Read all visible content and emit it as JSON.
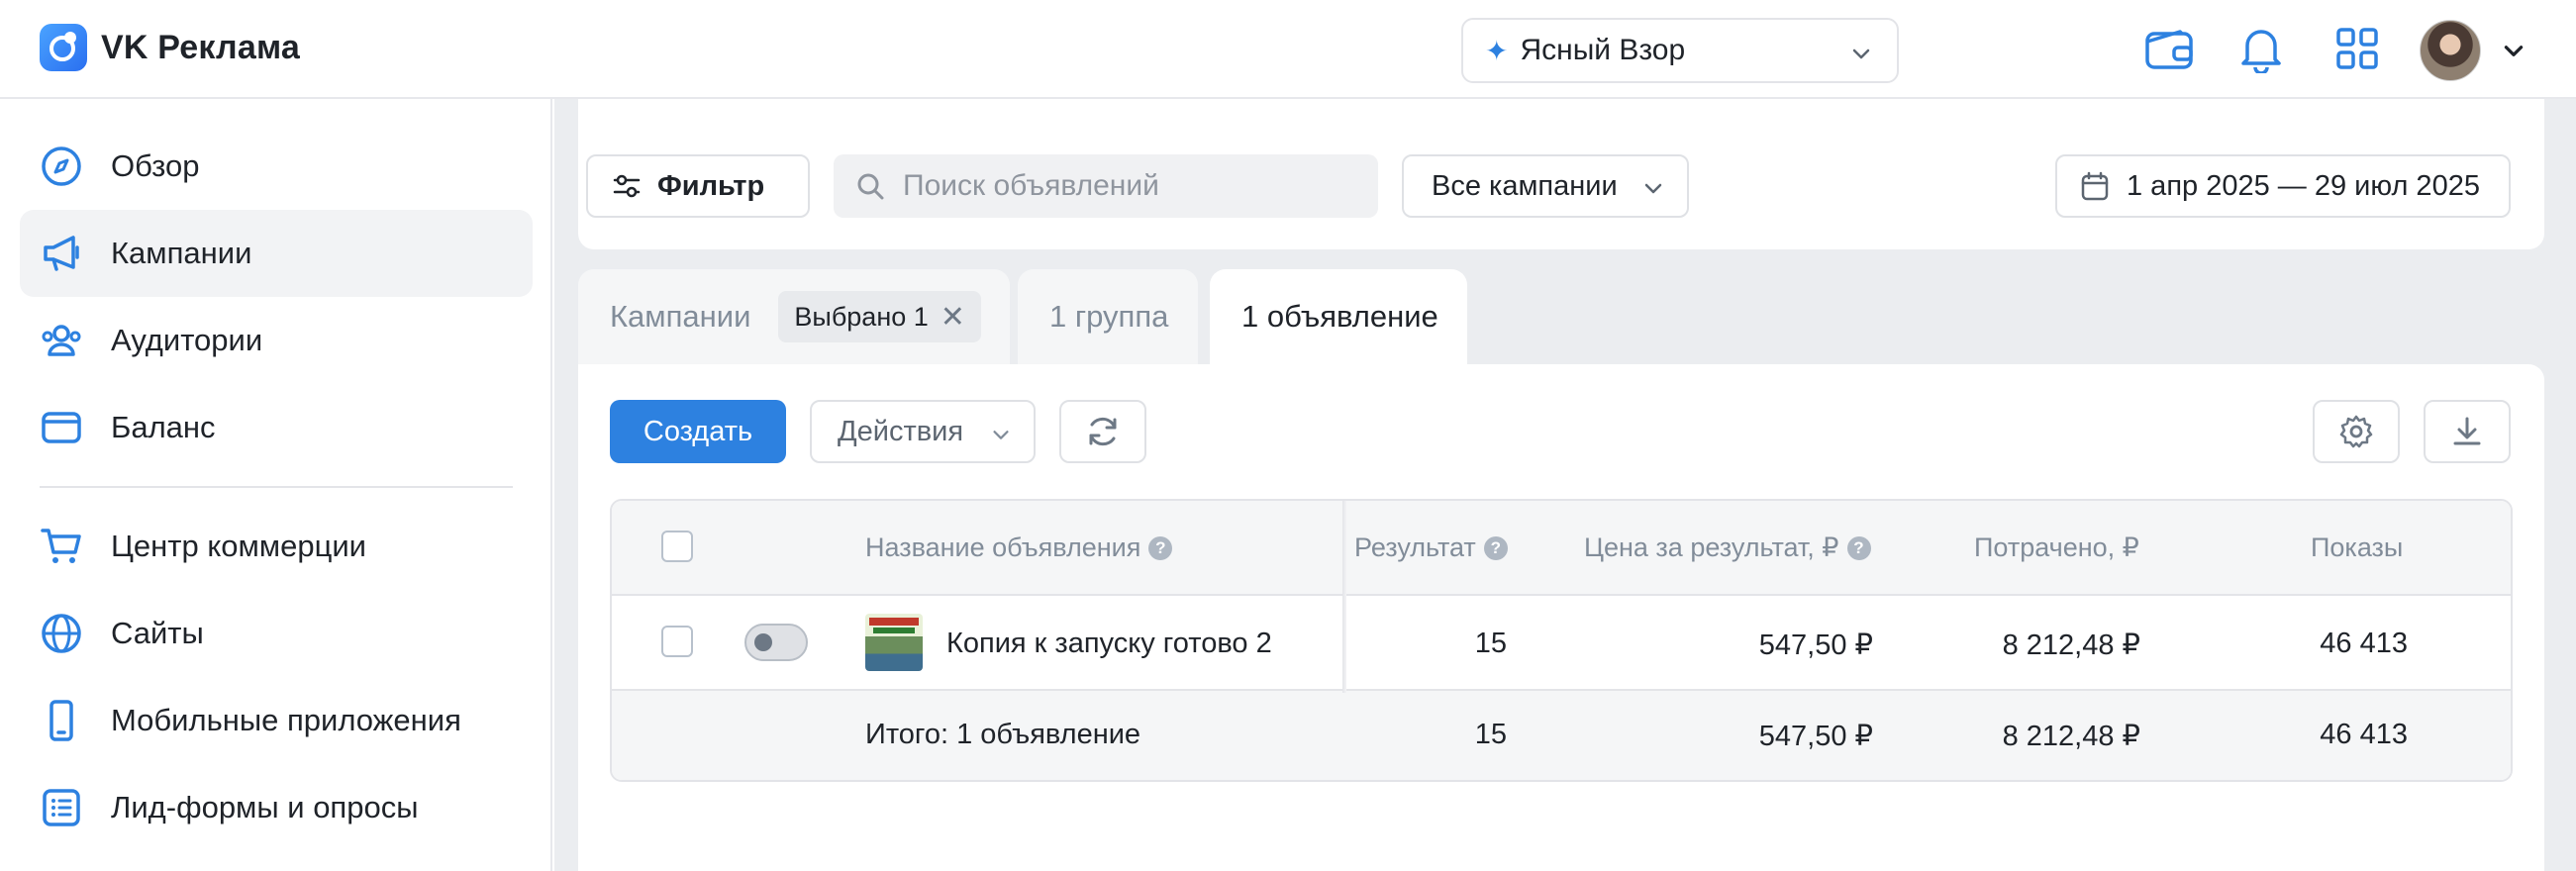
{
  "app": {
    "title": "VK Реклама"
  },
  "account": {
    "name": "Ясный Взор"
  },
  "sidebar": {
    "items": [
      {
        "label": "Обзор",
        "icon": "compass-icon"
      },
      {
        "label": "Кампании",
        "icon": "megaphone-icon",
        "active": true
      },
      {
        "label": "Аудитории",
        "icon": "users-icon"
      },
      {
        "label": "Баланс",
        "icon": "wallet-icon"
      },
      {
        "label": "Центр коммерции",
        "icon": "cart-icon"
      },
      {
        "label": "Сайты",
        "icon": "globe-icon"
      },
      {
        "label": "Мобильные приложения",
        "icon": "phone-icon"
      },
      {
        "label": "Лид-формы и опросы",
        "icon": "form-icon"
      }
    ]
  },
  "toolbar": {
    "filter_label": "Фильтр",
    "search_placeholder": "Поиск объявлений",
    "campaign_select": "Все кампании",
    "date_range": "1 апр 2025 — 29 июл 2025"
  },
  "tabs": {
    "campaigns": "Кампании",
    "selected_chip": "Выбрано 1",
    "groups": "1 группа",
    "ads": "1 объявление"
  },
  "actions": {
    "create": "Создать",
    "actions": "Действия"
  },
  "table": {
    "headers": {
      "name": "Название объявления",
      "result": "Результат",
      "price": "Цена за результат, ₽",
      "spent": "Потрачено, ₽",
      "shows": "Показы"
    },
    "rows": [
      {
        "name": "Копия к запуску готово 2",
        "result": "15",
        "price": "547,50 ₽",
        "spent": "8 212,48 ₽",
        "shows": "46 413"
      }
    ],
    "total": {
      "label": "Итого: 1 объявление",
      "result": "15",
      "price": "547,50 ₽",
      "spent": "8 212,48 ₽",
      "shows": "46 413"
    }
  },
  "colors": {
    "accent": "#2d81e0",
    "icon_blue": "#2d81e0"
  }
}
